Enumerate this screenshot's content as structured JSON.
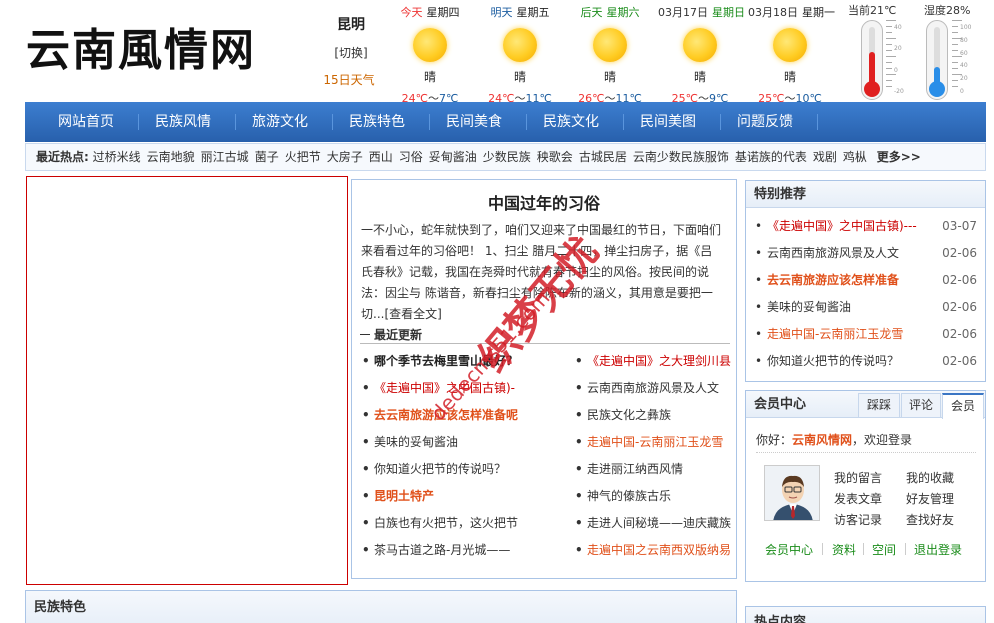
{
  "site": {
    "logo": "云南風情网"
  },
  "city": {
    "name": "昆明",
    "switch": "[切换]",
    "forecast_link": "15日天气"
  },
  "weather": [
    {
      "day": "今天",
      "week": "星期四",
      "desc": "晴",
      "hi": "24℃",
      "sep": "～",
      "lo": "7℃"
    },
    {
      "day": "明天",
      "week": "星期五",
      "desc": "晴",
      "hi": "24℃",
      "sep": "～",
      "lo": "11℃"
    },
    {
      "day": "后天",
      "week": "星期六",
      "desc": "晴",
      "hi": "26℃",
      "sep": "～",
      "lo": "11℃"
    },
    {
      "day": "03月17日",
      "week": "星期日",
      "desc": "晴",
      "hi": "25℃",
      "sep": "～",
      "lo": "9℃"
    },
    {
      "day": "03月18日",
      "week": "星期一",
      "desc": "晴",
      "hi": "25℃",
      "sep": "～",
      "lo": "10℃"
    }
  ],
  "gauges": {
    "temperature": {
      "label": "当前21℃",
      "level": 0.55,
      "color": "#e02020",
      "ticks": [
        "40",
        "20",
        "0",
        "-20"
      ]
    },
    "humidity": {
      "label": "湿度28%",
      "level": 0.28,
      "color": "#2a8ee8",
      "ticks": [
        "100",
        "80",
        "60",
        "40",
        "20",
        "0"
      ]
    }
  },
  "nav": [
    "网站首页",
    "民族风情",
    "旅游文化",
    "民族特色",
    "民间美食",
    "民族文化",
    "民间美图",
    "问题反馈"
  ],
  "hot": {
    "title": "最近热点:",
    "items": [
      "过桥米线",
      "云南地貌",
      "丽江古城",
      "菌子",
      "火把节",
      "大房子",
      "西山",
      "习俗",
      "妥甸酱油",
      "少数民族",
      "秧歌会",
      "古城民居",
      "云南少数民族服饰",
      "基诺族的代表",
      "戏剧",
      "鸡枞"
    ],
    "more": "更多>>"
  },
  "article": {
    "title": "中国过年的习俗",
    "body": "一不小心，蛇年就快到了，咱们又迎来了中国最红的节日，下面咱们来看看过年的习俗吧！ 1、扫尘 腊月二十四，掸尘扫房子，据《吕氏春秋》记载，我国在尧舜时代就有春节扫尘的风俗。按民间的说法：因尘与 陈谐音，新春扫尘有除陈布新的涵义，其用意是要把一切...",
    "more": "[查看全文]"
  },
  "latest": {
    "title": "最近更新",
    "left": [
      {
        "text": "哪个季节去梅里雪山最好？",
        "style": "dark-b"
      },
      {
        "text": "《走遍中国》之中国古镇)-",
        "style": "red"
      },
      {
        "text": "去云南旅游应该怎样准备呢",
        "style": "orange-b"
      },
      {
        "text": "美味的妥甸酱油",
        "style": "dark"
      },
      {
        "text": "你知道火把节的传说吗？",
        "style": "dark"
      },
      {
        "text": "昆明土特产",
        "style": "orange-b"
      },
      {
        "text": "白族也有火把节，这火把节",
        "style": "dark"
      },
      {
        "text": "茶马古道之路-月光城——",
        "style": "dark"
      }
    ],
    "right": [
      {
        "text": "《走遍中国》之大理剑川县",
        "style": "red"
      },
      {
        "text": "云南西南旅游风景及人文",
        "style": "dark"
      },
      {
        "text": "民族文化之彝族",
        "style": "dark"
      },
      {
        "text": "走遍中国-云南丽江玉龙雪",
        "style": "orange"
      },
      {
        "text": "走进丽江纳西风情",
        "style": "dark"
      },
      {
        "text": "神气的傣族古乐",
        "style": "dark"
      },
      {
        "text": "走进人间秘境——迪庆藏族",
        "style": "dark"
      },
      {
        "text": "走遍中国之云南西双版纳易",
        "style": "orange"
      }
    ]
  },
  "recommend": {
    "title": "特别推荐",
    "items": [
      {
        "text": "《走遍中国》之中国古镇)---",
        "date": "03-07",
        "style": "red"
      },
      {
        "text": "云南西南旅游风景及人文",
        "date": "02-06",
        "style": "dark"
      },
      {
        "text": "去云南旅游应该怎样准备",
        "date": "02-06",
        "style": "orange-b"
      },
      {
        "text": "美味的妥甸酱油",
        "date": "02-06",
        "style": "dark"
      },
      {
        "text": "走遍中国-云南丽江玉龙雪",
        "date": "02-06",
        "style": "orange"
      },
      {
        "text": "你知道火把节的传说吗？",
        "date": "02-06",
        "style": "dark"
      }
    ]
  },
  "member": {
    "title": "会员中心",
    "tabs": [
      "踩踩",
      "评论",
      "会员"
    ],
    "welcome_prefix": "你好：",
    "welcome_site": "云南风情网",
    "welcome_suffix": "，欢迎登录",
    "links": [
      "我的留言",
      "我的收藏",
      "发表文章",
      "好友管理",
      "访客记录",
      "查找好友"
    ],
    "bottom": [
      "会员中心",
      "资料",
      "空间",
      "退出登录"
    ]
  },
  "sections": {
    "ethnic": "民族特色",
    "hot": "热点内容"
  },
  "watermark": {
    "big": "织梦无忧",
    "small": "dedecms51.com"
  }
}
